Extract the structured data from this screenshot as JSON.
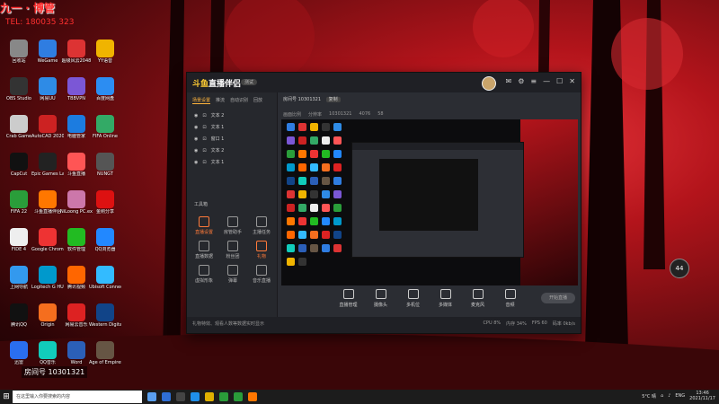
{
  "overlay": {
    "top_text": "九一 · 博管",
    "sub_text": "TEL: 180035 323"
  },
  "desktop_icons": [
    {
      "label": "回收站",
      "color": "#888"
    },
    {
      "label": "WeGame",
      "color": "#2f7de1"
    },
    {
      "label": "超级风云2048",
      "color": "#d33"
    },
    {
      "label": "YY语音",
      "color": "#f0b400"
    },
    {
      "label": "OBS Studio",
      "color": "#333"
    },
    {
      "label": "网易UU",
      "color": "#2e8be6"
    },
    {
      "label": "TBBVPN",
      "color": "#7b57d6"
    },
    {
      "label": "百度网盘",
      "color": "#2c8df2"
    },
    {
      "label": "Crab Game",
      "color": "#ccc"
    },
    {
      "label": "AutoCAD 2020",
      "color": "#c22"
    },
    {
      "label": "电脑管家",
      "color": "#1c7ce0"
    },
    {
      "label": "FIFA Online",
      "color": "#3a6"
    },
    {
      "label": "CapCut",
      "color": "#111"
    },
    {
      "label": "Epic Games Launcher",
      "color": "#222"
    },
    {
      "label": "斗鱼直播",
      "color": "#f55"
    },
    {
      "label": "NUNGT",
      "color": "#555"
    },
    {
      "label": "FIFA 22",
      "color": "#2a9d3a"
    },
    {
      "label": "斗鱼直播伴侣",
      "color": "#f70"
    },
    {
      "label": "NiLoong PC.exe",
      "color": "#c7a"
    },
    {
      "label": "金刚分享",
      "color": "#d11"
    },
    {
      "label": "FIDE 4",
      "color": "#eee"
    },
    {
      "label": "Google Chrome",
      "color": "#e33"
    },
    {
      "label": "软件管理",
      "color": "#2b2"
    },
    {
      "label": "QQ浏览器",
      "color": "#28f"
    },
    {
      "label": "上网导航",
      "color": "#39e"
    },
    {
      "label": "Logitech G HUB",
      "color": "#09c"
    },
    {
      "label": "腾讯视频",
      "color": "#f60"
    },
    {
      "label": "Ubisoft Connect",
      "color": "#3bf"
    },
    {
      "label": "腾讯QQ",
      "color": "#111"
    },
    {
      "label": "Origin",
      "color": "#f56e1e"
    },
    {
      "label": "网易云音乐",
      "color": "#d22"
    },
    {
      "label": "Western Digital",
      "color": "#148"
    },
    {
      "label": "迅雷",
      "color": "#2a6ef0"
    },
    {
      "label": "QQ音乐",
      "color": "#1cb"
    },
    {
      "label": "Word",
      "color": "#2b5fb8"
    },
    {
      "label": "Age of Empires IV",
      "color": "#654"
    }
  ],
  "live_window": {
    "logo_main": "直播伴侣",
    "logo_prefix": "斗鱼",
    "version_pill": "测试",
    "left_tabs": [
      "场景设置",
      "推流",
      "自动识别",
      "回放"
    ],
    "scenes": [
      "文本 2",
      "文本 1",
      "窗口 1",
      "文本 2",
      "文本 1"
    ],
    "tools_title": "工具箱",
    "tools": [
      {
        "label": "直播设置",
        "on": true
      },
      {
        "label": "房管助手",
        "on": false
      },
      {
        "label": "主播任务",
        "on": false
      },
      {
        "label": "直播数据",
        "on": false
      },
      {
        "label": "粉丝团",
        "on": false
      },
      {
        "label": "礼物",
        "on": true
      },
      {
        "label": "虚拟形象",
        "on": false
      },
      {
        "label": "弹幕",
        "on": false
      },
      {
        "label": "音乐直播",
        "on": false
      }
    ],
    "room_label": "房间号 10301321",
    "room_btn": "复制",
    "bar_items": [
      "画面比例",
      "分辨率",
      "10301321",
      "4076",
      "58"
    ],
    "controls": [
      "直播管理",
      "摄像头",
      "多机位",
      "多媒体",
      "麦克风",
      "音频"
    ],
    "start_live": "开始直播",
    "status_text": "礼物特效、观看人数等数据实时显示",
    "status_stats": [
      "CPU 8%",
      "内存 34%",
      "FPS 60",
      "码率 0kb/s"
    ]
  },
  "speed_badge": "44",
  "watermark": "房间号 10301321",
  "taskbar": {
    "search_placeholder": "在这里输入你要搜索的内容",
    "apps": [
      "#5aa0f0",
      "#2f6fd6",
      "#444",
      "#1f8fe8",
      "#e0b000",
      "#2a9d3a",
      "#2a9d3a",
      "#f70"
    ],
    "temp": "5°C 晴",
    "lang": "ENG",
    "time": "13:46",
    "date": "2021/11/17"
  }
}
